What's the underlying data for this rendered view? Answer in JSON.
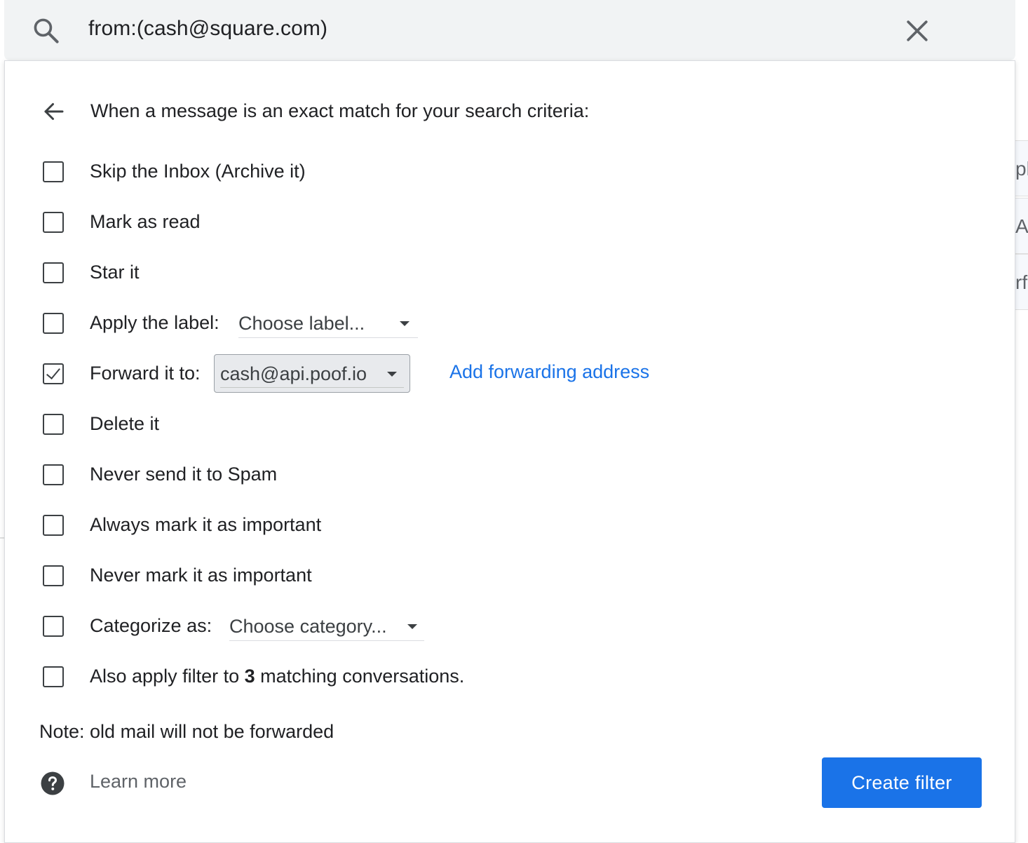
{
  "search": {
    "query": "from:(cash@square.com)"
  },
  "filter_panel": {
    "header": "When a message is an exact match for your search criteria:",
    "options": [
      {
        "label": "Skip the Inbox (Archive it)",
        "checked": false
      },
      {
        "label": "Mark as read",
        "checked": false
      },
      {
        "label": "Star it",
        "checked": false
      },
      {
        "label": "Apply the label:",
        "checked": false
      },
      {
        "label": "Forward it to:",
        "checked": true
      },
      {
        "label": "Delete it",
        "checked": false
      },
      {
        "label": "Never send it to Spam",
        "checked": false
      },
      {
        "label": "Always mark it as important",
        "checked": false
      },
      {
        "label": "Never mark it as important",
        "checked": false
      },
      {
        "label": "Categorize as:",
        "checked": false
      },
      {
        "label_prefix": "Also apply filter to ",
        "label_count": "3",
        "label_suffix": " matching conversations.",
        "checked": false
      }
    ],
    "label_dropdown": "Choose label...",
    "forward_select": "cash@api.poof.io",
    "add_forwarding_link": "Add forwarding address",
    "category_dropdown": "Choose category...",
    "note": "Note: old mail will not be forwarded",
    "learn_more": "Learn more",
    "create_filter": "Create filter"
  },
  "background_list": {
    "row_fragments": [
      "ph",
      "A",
      "rf"
    ]
  },
  "colors": {
    "accent": "#1a73e8",
    "search_bg": "#f1f3f4",
    "text": "#202124"
  }
}
